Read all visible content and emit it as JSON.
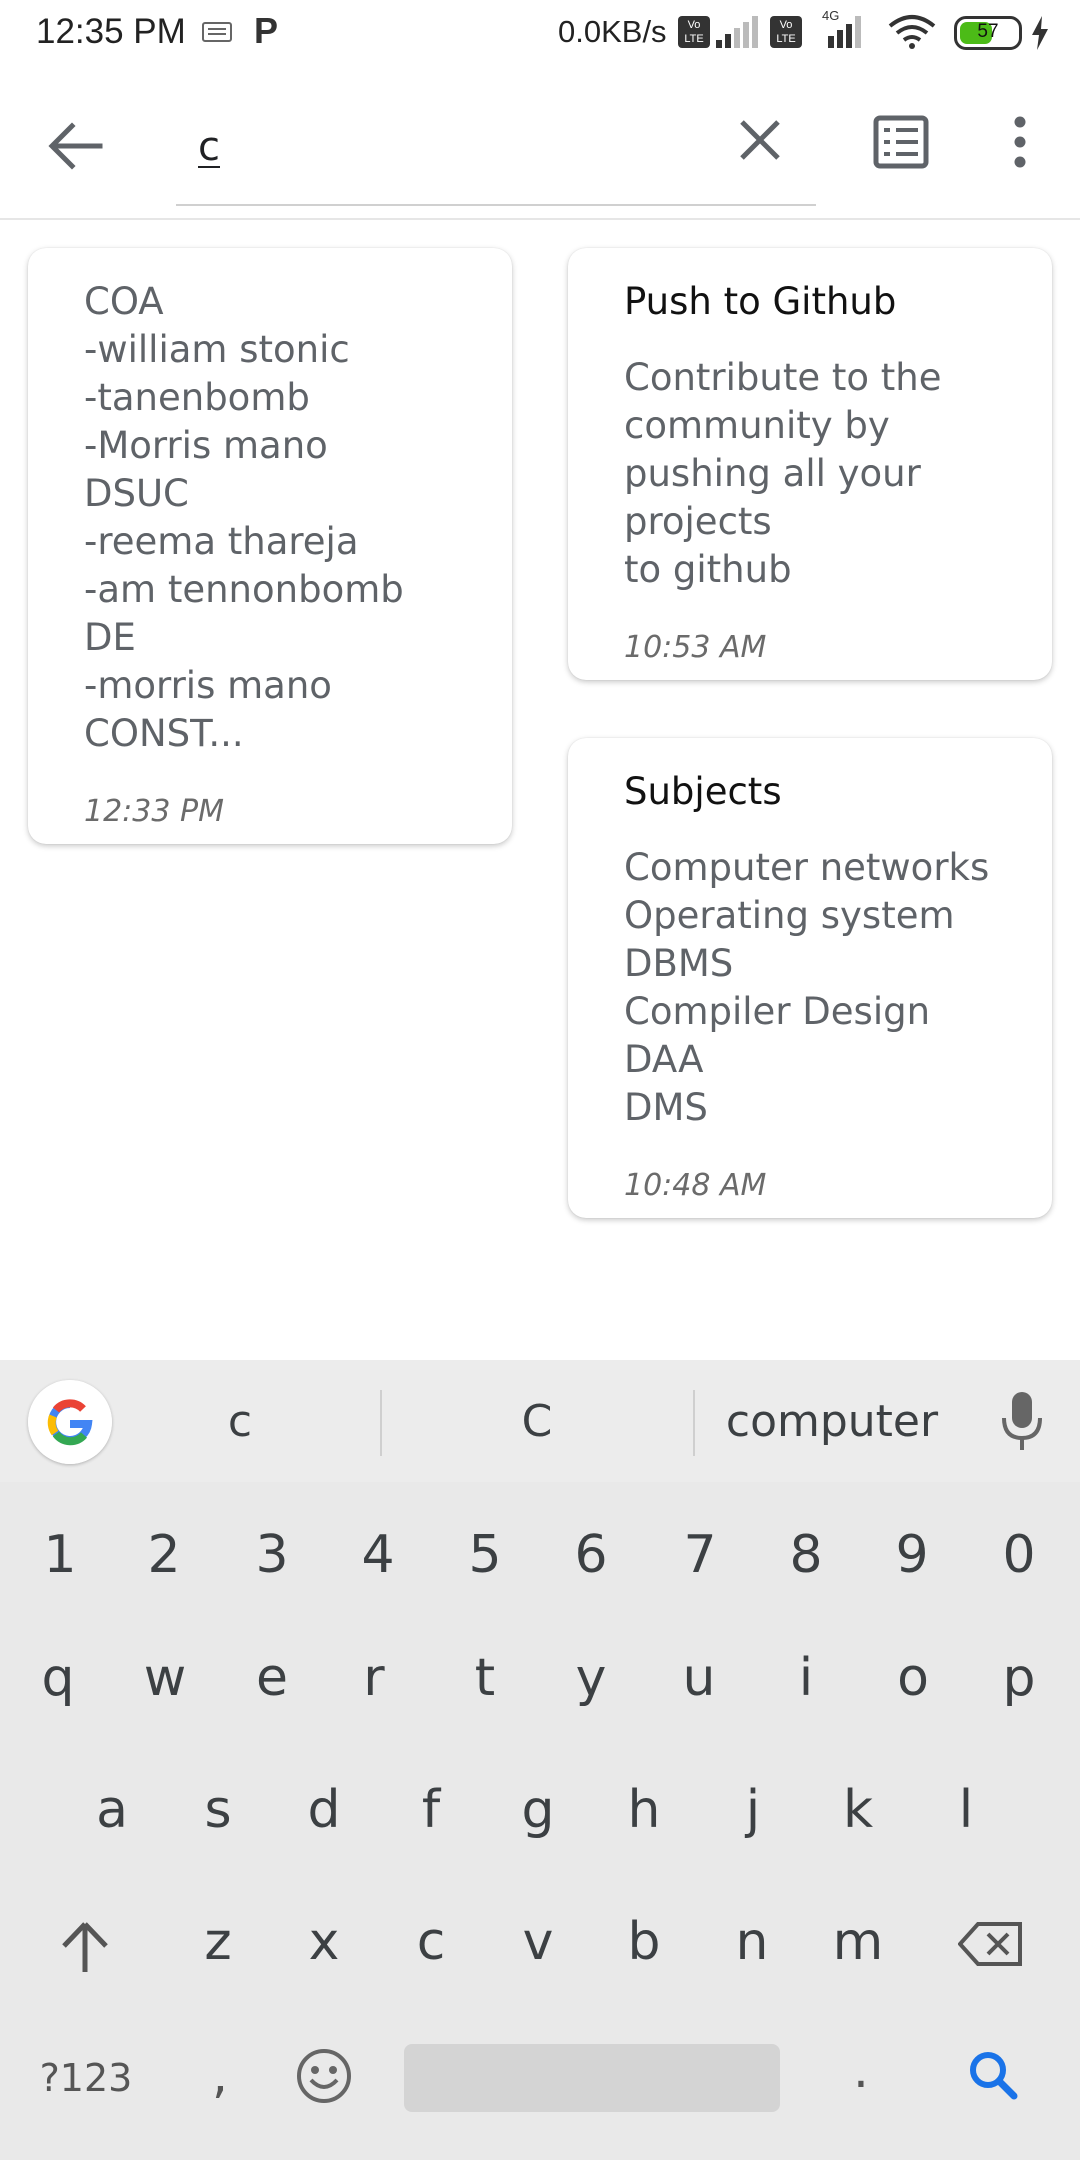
{
  "status_bar": {
    "time": "12:35 PM",
    "network_speed": "0.0KB/s",
    "volte": "Vo LTE",
    "network_type": "4G",
    "battery": "57",
    "battery_level": 0.57
  },
  "search": {
    "query": "c"
  },
  "notes": [
    {
      "title": "",
      "lines": [
        "COA",
        "-william stonic",
        "-tanenbomb",
        "-Morris mano",
        "DSUC",
        "-reema thareja",
        "-am tennonbomb",
        "DE",
        "-morris mano",
        "CONST..."
      ],
      "time": "12:33 PM"
    },
    {
      "title": "Push to Github",
      "lines": [
        "Contribute to the",
        "community by",
        "pushing all your",
        "projects",
        "to github"
      ],
      "time": "10:53 AM"
    },
    {
      "title": "Subjects",
      "lines": [
        "Computer networks",
        "Operating system",
        "DBMS",
        "Compiler Design",
        "DAA",
        "DMS"
      ],
      "time": "10:48 AM"
    }
  ],
  "keyboard": {
    "suggestions": [
      "c",
      "C",
      "computer"
    ],
    "number_row": [
      "1",
      "2",
      "3",
      "4",
      "5",
      "6",
      "7",
      "8",
      "9",
      "0"
    ],
    "row1": [
      "q",
      "w",
      "e",
      "r",
      "t",
      "y",
      "u",
      "i",
      "o",
      "p"
    ],
    "row2": [
      "a",
      "s",
      "d",
      "f",
      "g",
      "h",
      "j",
      "k",
      "l"
    ],
    "row3": [
      "z",
      "x",
      "c",
      "v",
      "b",
      "n",
      "m"
    ],
    "symbols_key": "?123",
    "comma_key": ",",
    "period_key": "."
  },
  "colors": {
    "accent_blue": "#1a73e8",
    "battery_green": "#4cbb17"
  },
  "icons": {
    "back": "arrow-left-icon",
    "clear": "close-icon",
    "layout": "list-view-icon",
    "overflow": "more-vert-icon",
    "mic": "microphone-icon",
    "shift": "shift-icon",
    "backspace": "backspace-icon",
    "emoji": "emoji-icon",
    "search": "search-icon",
    "google": "google-logo"
  }
}
